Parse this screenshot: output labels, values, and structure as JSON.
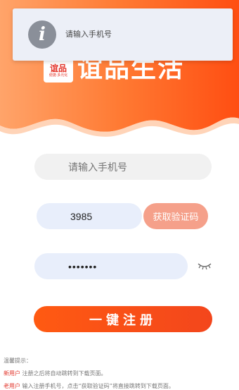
{
  "header": {
    "logo_main": "谊品",
    "logo_sub": "便捷·多元化",
    "brand": "谊品生活",
    "colors": {
      "gradient_start": "#ff9d5c",
      "gradient_end": "#ff4f10"
    }
  },
  "toast": {
    "icon": "info-icon",
    "message": "请输入手机号"
  },
  "form": {
    "phone_placeholder": "请输入手机号",
    "code_value": "3985",
    "sms_button_label": "获取验证码",
    "password_value": "•••••••",
    "password_toggle_icon": "eye-closed-icon",
    "register_button_label": "一键注册"
  },
  "tips": {
    "heading": "温馨提示：",
    "new_user_label": "新用户",
    "new_user_text": " 注册之后将自动跳转到下载页面。",
    "old_user_label": "老用户",
    "old_user_text": " 输入注册手机号，点击“获取验证码”将直接跳转到下载页面。"
  }
}
